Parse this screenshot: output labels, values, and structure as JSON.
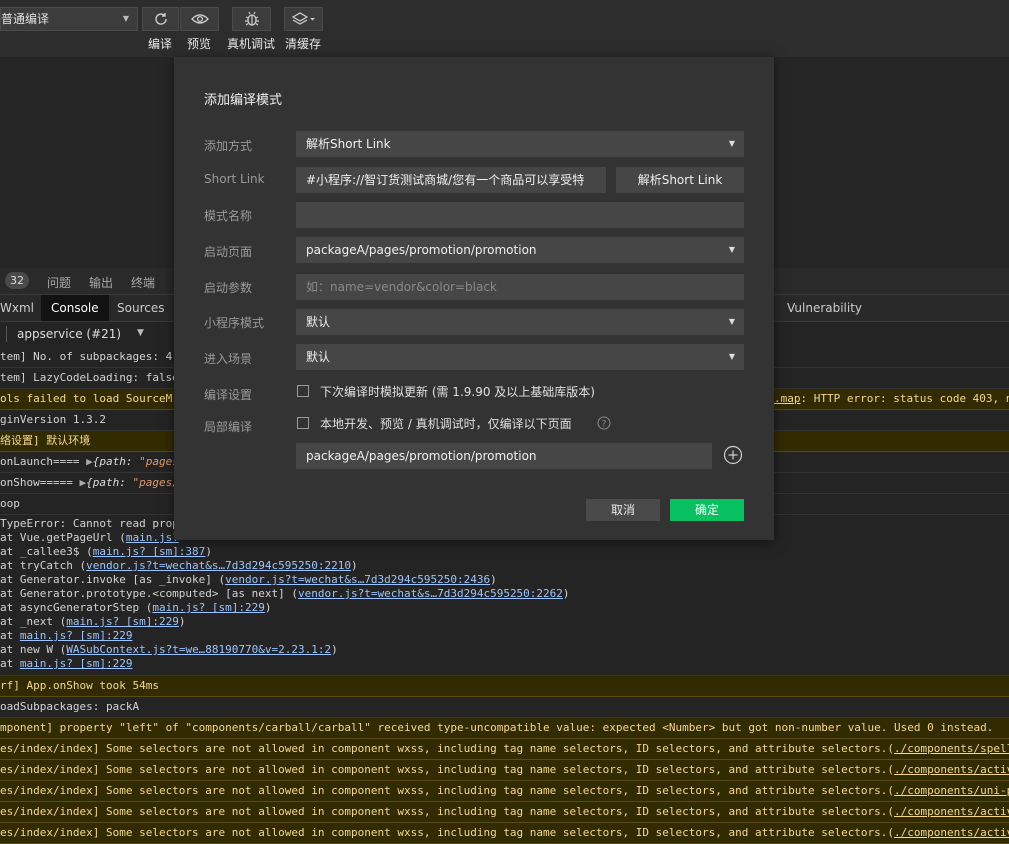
{
  "toolbar": {
    "compile_mode": "普通编译",
    "buttons": [
      {
        "label": "编译",
        "icon": "refresh-icon"
      },
      {
        "label": "预览",
        "icon": "eye-icon"
      },
      {
        "label": "真机调试",
        "icon": "bug-icon"
      },
      {
        "label": "清缓存",
        "icon": "layers-icon"
      }
    ]
  },
  "devtools": {
    "count_badge": "32",
    "panel_tabs": [
      "问题",
      "输出",
      "终端"
    ],
    "tabs": [
      "Wxml",
      "Console",
      "Sources",
      "Vulnerability"
    ],
    "context": "appservice (#21)"
  },
  "console_lines": [
    "tem] No. of subpackages: 4",
    "tem] LazyCodeLoading: false",
    "ols failed to load SourceM",
    "ginVersion 1.3.2",
    "络设置] 默认环境",
    "onLaunch==== ",
    "onShow===== ",
    "oop",
    "TypeError: Cannot read prop",
    "at Vue.getPageUrl (",
    "at _callee3$ (",
    "at tryCatch (",
    "at Generator.invoke [as _invoke] (",
    "at Generator.prototype.<computed> [as next] (",
    "at asyncGeneratorStep (",
    "at _next (",
    "at ",
    "at new W (",
    "at ",
    "rf] App.onShow took 54ms",
    "oadSubpackages: packA",
    "mponent] property \"left\" of \"components/carball/carball\" received type-uncompatible value: expected <Number> but got non-number value. Used 0 instead.",
    "es/index/index] Some selectors are not allowed in component wxss, including tag name selectors, ID selectors, and attribute selectors.("
  ],
  "console_links": {
    "sourcemap_tail": ".map",
    "sourcemap_err": ": HTTP error: status code 403, n",
    "main_short": "main.js?",
    "main_sm": "main.js? [sm]:387",
    "vendor_2210": "vendor.js?t=wechat&s…7d3d294c595250:2210",
    "vendor_2436": "vendor.js?t=wechat&s…7d3d294c595250:2436",
    "vendor_2262": "vendor.js?t=wechat&s…7d3d294c595250:2262",
    "main_229": "main.js? [sm]:229",
    "wasub": "WASubContext.js?t=we…88190770&v=2.23.1:2",
    "path_obj": "{path: ",
    "path_pages": "\"pages",
    "path_pages2": "\"pages/",
    "close_paren": ")",
    "wxss_links": [
      "./components/spell-",
      "./components/activi",
      "./components/uni-po",
      "./components/activi",
      "./components/activi"
    ]
  },
  "modal": {
    "title": "添加编译模式",
    "labels": {
      "add_method": "添加方式",
      "short_link": "Short Link",
      "mode_name": "模式名称",
      "start_page": "启动页面",
      "start_params": "启动参数",
      "mp_mode": "小程序模式",
      "scene": "进入场景",
      "compile_settings": "编译设置",
      "partial_compile": "局部编译"
    },
    "add_method_value": "解析Short Link",
    "short_link_value": "#小程序://智订货测试商城/您有一个商品可以享受特",
    "parse_button": "解析Short Link",
    "mode_name_value": "",
    "start_page_value": "packageA/pages/promotion/promotion",
    "start_params_placeholder": "如：name=vendor&color=black",
    "mp_mode_value": "默认",
    "scene_value": "默认",
    "compile_settings_text": "下次编译时模拟更新 (需 1.9.90 及以上基础库版本)",
    "partial_compile_text": "本地开发、预览 / 真机调试时，仅编译以下页面",
    "partial_page_value": "packageA/pages/promotion/promotion",
    "cancel": "取消",
    "confirm": "确定",
    "colors": {
      "confirm": "#07c160",
      "cancel": "#4a4a4a"
    }
  }
}
